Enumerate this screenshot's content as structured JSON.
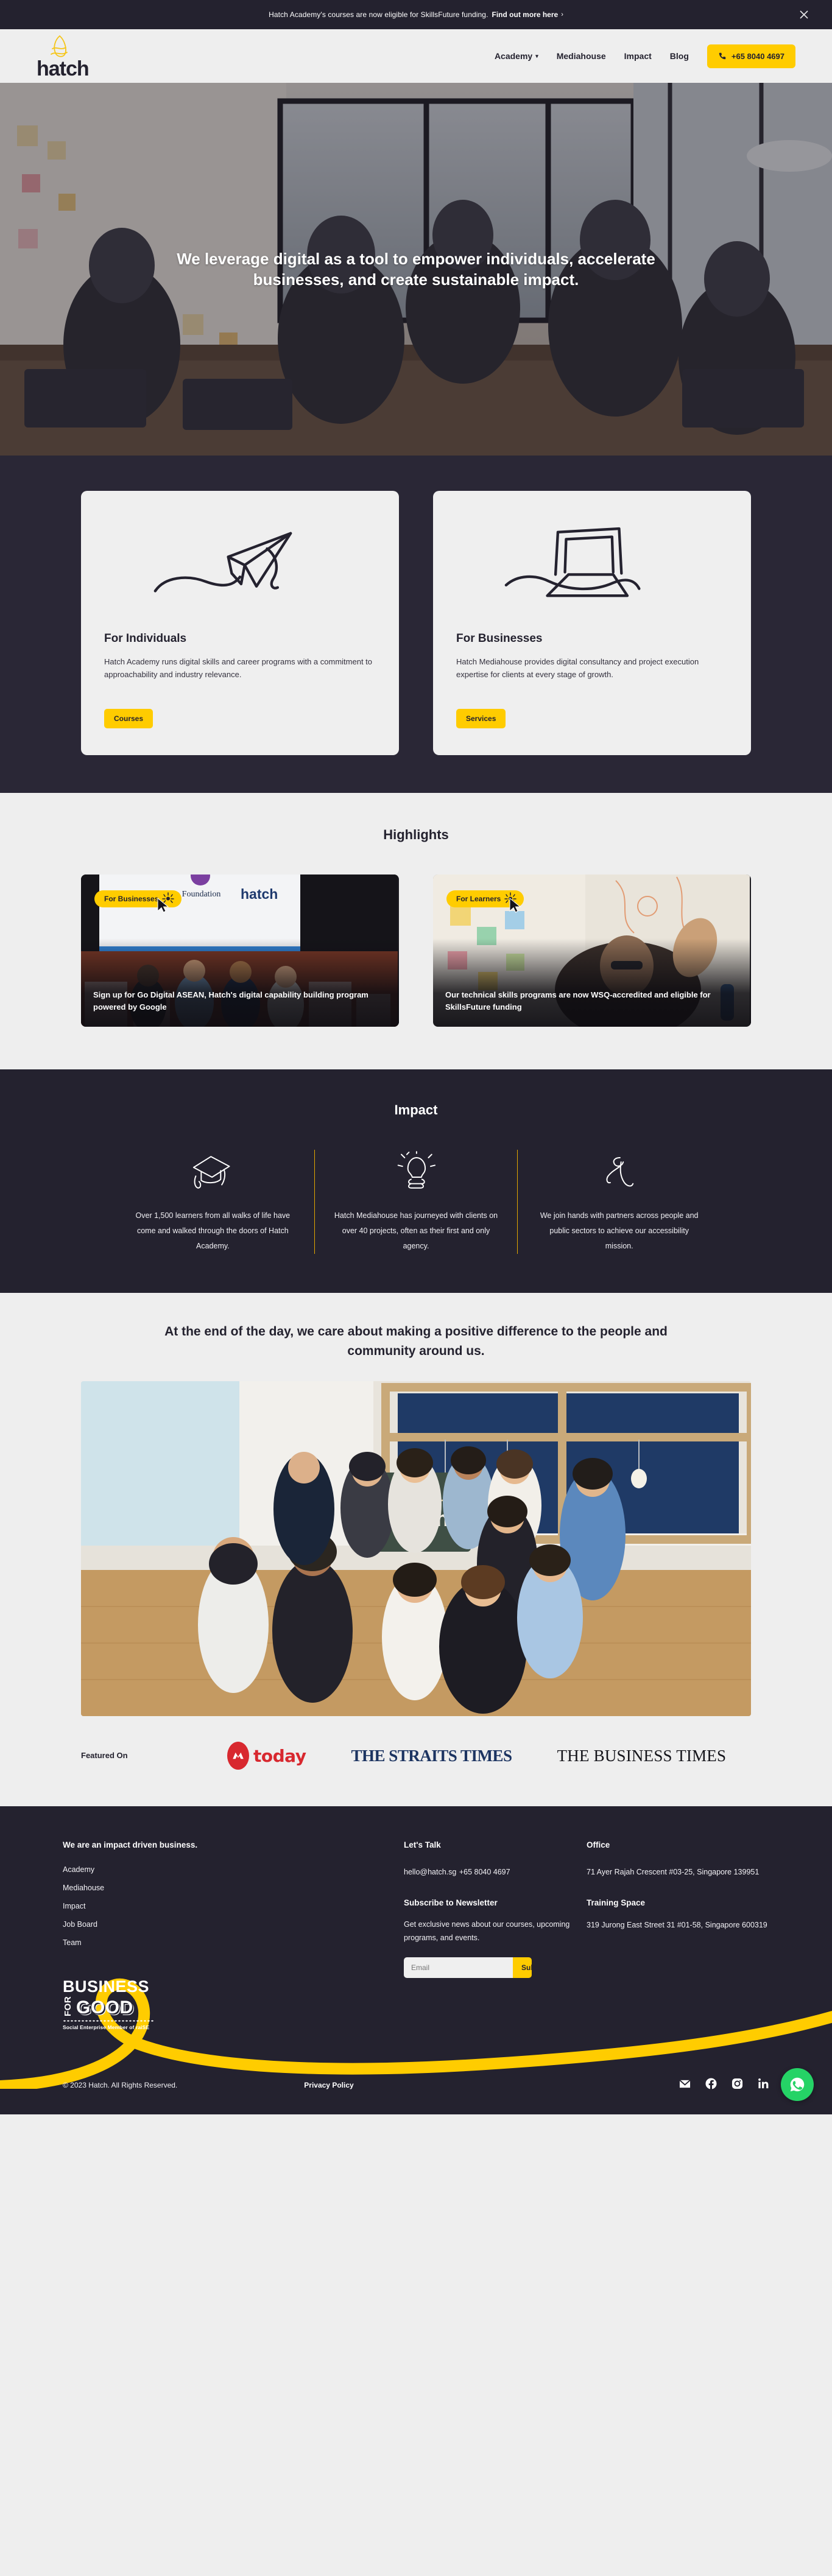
{
  "announcement": {
    "text": "Hatch Academy's courses are now eligible for SkillsFuture funding.",
    "link_label": "Find out more here",
    "chevron": "›",
    "close_icon": "close-icon"
  },
  "nav": {
    "logo_text": "hatch",
    "items": [
      {
        "label": "Academy",
        "has_dropdown": true,
        "caret": "⌄"
      },
      {
        "label": "Mediahouse",
        "has_dropdown": false
      },
      {
        "label": "Impact",
        "has_dropdown": false
      },
      {
        "label": "Blog",
        "has_dropdown": false
      }
    ],
    "phone_label": "+65 8040 4697"
  },
  "hero": {
    "title": "We leverage digital as a tool to empower individuals, accelerate businesses, and create sustainable impact."
  },
  "offerings": [
    {
      "icon": "paper-plane-icon",
      "title": "For Individuals",
      "body": "Hatch Academy runs digital skills and career programs with a commitment to approachability and industry relevance.",
      "cta": "Courses"
    },
    {
      "icon": "laptop-icon",
      "title": "For Businesses",
      "body": "Hatch Mediahouse provides digital consultancy and project execution expertise for clients at every stage of growth.",
      "cta": "Services"
    }
  ],
  "highlights": {
    "title": "Highlights",
    "cards": [
      {
        "tag": "For Businesses",
        "caption": "Sign up for Go Digital ASEAN, Hatch's digital capability building program powered by Google"
      },
      {
        "tag": "For Learners",
        "caption": "Our technical skills programs are now WSQ-accredited and eligible for SkillsFuture funding"
      }
    ]
  },
  "impact": {
    "title": "Impact",
    "columns": [
      {
        "icon": "graduation-cap-icon",
        "text": "Over 1,500 learners from all walks of life have come and walked through the doors of Hatch Academy."
      },
      {
        "icon": "lightbulb-hand-icon",
        "text": "Hatch Mediahouse has journeyed with clients on over 40 projects, often as their first and only agency."
      },
      {
        "icon": "sprout-icon",
        "text": "We join hands with partners across people and public sectors to achieve our accessibility mission."
      }
    ]
  },
  "community": {
    "heading": "At the end of the day, we care about making a positive difference to the people and community around us.",
    "photo_alt": "hatch team group photo holding chalkboard sign"
  },
  "featured": {
    "label": "Featured On",
    "logos": [
      {
        "name": "today-logo",
        "text": "today"
      },
      {
        "name": "straits-times-logo",
        "text": "THE STRAITS TIMES"
      },
      {
        "name": "business-times-logo",
        "text": "THE BUSINESS TIMES"
      }
    ]
  },
  "footer": {
    "tagline": "We are an impact driven business.",
    "links": [
      "Academy",
      "Mediahouse",
      "Impact",
      "Job Board",
      "Team"
    ],
    "lets_talk": {
      "heading": "Let's Talk",
      "email": "hello@hatch.sg",
      "phone": "+65 8040 4697"
    },
    "newsletter": {
      "heading": "Subscribe to Newsletter",
      "description": "Get exclusive news about our courses, upcoming programs, and events.",
      "input_placeholder": "Email",
      "input_value": "",
      "submit_label": "Submit"
    },
    "office": {
      "heading": "Office",
      "address": "71 Ayer Rajah Crescent #03-25, Singapore 139951"
    },
    "training_space": {
      "heading": "Training Space",
      "address": "319 Jurong East Street 31 #01-58, Singapore 600319"
    },
    "badge": {
      "line1": "BUSINESS",
      "line2": "FOR",
      "line3": "GOOD",
      "line4": "Social Enterprise Member of raiSE"
    },
    "copyright": "© 2023 Hatch. All Rights Reserved.",
    "privacy_label": "Privacy Policy",
    "socials": [
      "mail-icon",
      "facebook-icon",
      "instagram-icon",
      "linkedin-icon"
    ],
    "whatsapp_fab": "whatsapp-icon"
  },
  "colors": {
    "brand_yellow": "#ffcc00",
    "dark": "#24222f",
    "panel_dark": "#2a2736",
    "light_bg": "#eeeeee",
    "whatsapp_green": "#25d366",
    "impact_divider": "#e3a700"
  }
}
